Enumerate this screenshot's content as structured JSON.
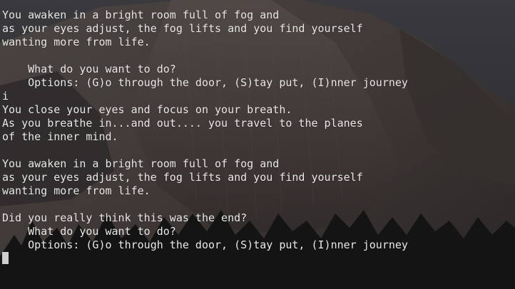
{
  "terminal": {
    "lines": [
      "",
      "You awaken in a bright room full of fog and",
      "as your eyes adjust, the fog lifts and you find yourself",
      "wanting more from life.",
      "",
      "    What do you want to do?",
      "    Options: (G)o through the door, (S)tay put, (I)nner journey",
      "i",
      "You close your eyes and focus on your breath.",
      "As you breathe in...and out.... you travel to the planes",
      "of the inner mind.",
      "",
      "You awaken in a bright room full of fog and",
      "as your eyes adjust, the fog lifts and you find yourself",
      "wanting more from life.",
      "",
      "Did you really think this was the end?",
      "    What do you want to do?",
      "    Options: (G)o through the door, (S)tay put, (I)nner journey"
    ]
  },
  "colors": {
    "text": "#eaeaea",
    "cursor": "#cfcfcf",
    "background": "#1c1b1d"
  }
}
